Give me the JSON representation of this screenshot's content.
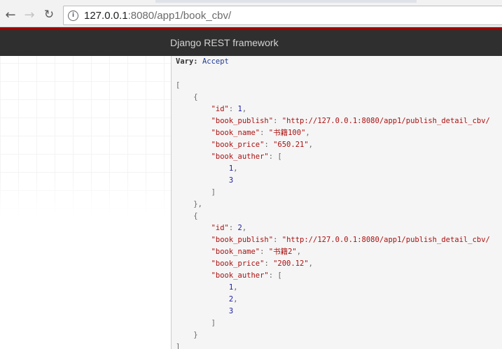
{
  "browser": {
    "back_icon": "back-arrow-icon",
    "forward_icon": "forward-arrow-icon",
    "reload_icon": "reload-icon",
    "info_icon": "info-icon",
    "url_host": "127.0.0.1",
    "url_rest": ":8080/app1/book_cbv/"
  },
  "navbar": {
    "brand": "Django REST framework",
    "accent_color": "#a30000"
  },
  "response": {
    "header_key": "Vary:",
    "header_value": "Accept",
    "books": [
      {
        "id": "1",
        "book_publish": "\"http://127.0.0.1:8080/app1/publish_detail_cbv/",
        "book_name": "\"书籍100\"",
        "book_price": "\"650.21\"",
        "book_auther": [
          "1",
          "3"
        ]
      },
      {
        "id": "2",
        "book_publish": "\"http://127.0.0.1:8080/app1/publish_detail_cbv/",
        "book_name": "\"书籍2\"",
        "book_price": "\"200.12\"",
        "book_auther": [
          "1",
          "2",
          "3"
        ]
      }
    ],
    "keys": {
      "id": "\"id\"",
      "book_publish": "\"book_publish\"",
      "book_name": "\"book_name\"",
      "book_price": "\"book_price\"",
      "book_auther": "\"book_auther\""
    }
  }
}
